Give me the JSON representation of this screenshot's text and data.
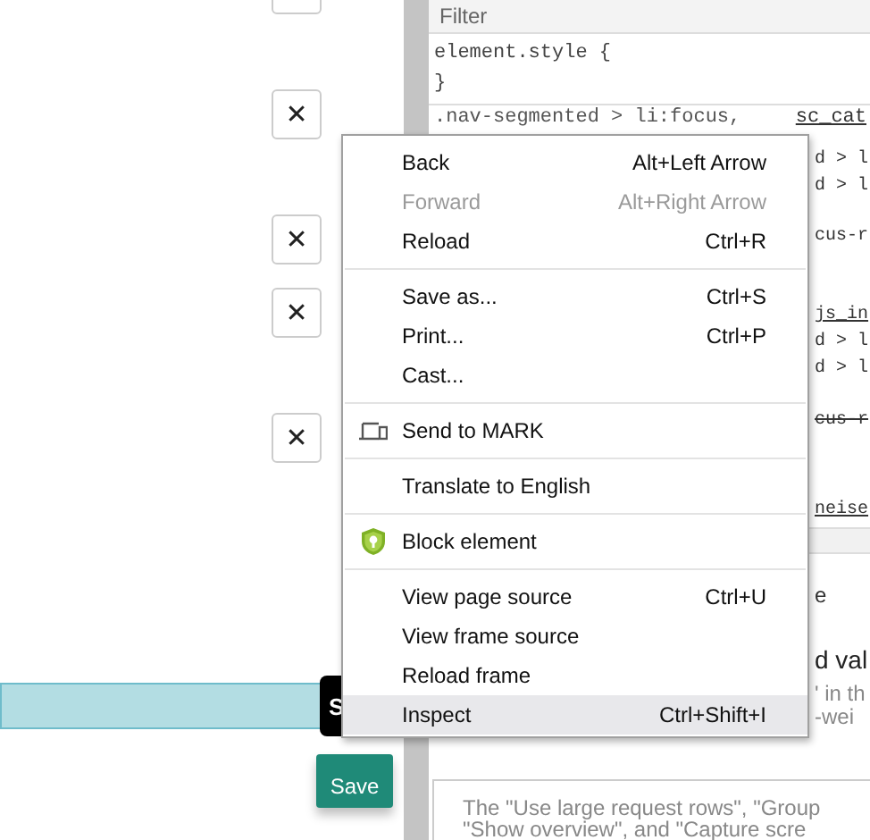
{
  "page": {
    "close_buttons": [
      {
        "kind": "cut"
      },
      {
        "kind": "x",
        "glyph": "✕"
      },
      {
        "kind": "x",
        "glyph": "✕"
      },
      {
        "kind": "x",
        "glyph": "✕"
      },
      {
        "kind": "x",
        "glyph": "✕"
      }
    ],
    "tooltip": "S",
    "save_button": "Save"
  },
  "devtools": {
    "filter": {
      "placeholder": "Filter"
    },
    "element_style": [
      "element.style {",
      "}"
    ],
    "rule": {
      "selector": ".nav-segmented > li:focus,",
      "source": "sc_cat"
    },
    "fragments": [
      {
        "kind": "code",
        "text": "d > l"
      },
      {
        "kind": "code",
        "text": "d > l"
      },
      {
        "kind": "code",
        "text": "cus-r"
      },
      {
        "kind": "link",
        "text": "js_in"
      },
      {
        "kind": "code",
        "text": "d > l"
      },
      {
        "kind": "code",
        "text": "d > l"
      },
      {
        "kind": "strike",
        "text": "cus-r"
      },
      {
        "kind": "link",
        "text": "neise"
      },
      {
        "kind": "band"
      },
      {
        "kind": "plain",
        "text": "e"
      },
      {
        "kind": "heading",
        "text": "d val"
      },
      {
        "kind": "muted",
        "text": "' in th"
      },
      {
        "kind": "muted",
        "text": "-wei"
      }
    ],
    "note_lines": [
      "The \"Use large request rows\", \"Group",
      "\"Show overview\", and \"Capture scre"
    ]
  },
  "context_menu": {
    "items": [
      {
        "kind": "item",
        "label": "Back",
        "shortcut": "Alt+Left Arrow",
        "disabled": false,
        "selected": false
      },
      {
        "kind": "item",
        "label": "Forward",
        "shortcut": "Alt+Right Arrow",
        "disabled": true,
        "selected": false
      },
      {
        "kind": "item",
        "label": "Reload",
        "shortcut": "Ctrl+R",
        "disabled": false,
        "selected": false
      },
      {
        "kind": "divider"
      },
      {
        "kind": "item",
        "label": "Save as...",
        "shortcut": "Ctrl+S",
        "disabled": false,
        "selected": false
      },
      {
        "kind": "item",
        "label": "Print...",
        "shortcut": "Ctrl+P",
        "disabled": false,
        "selected": false
      },
      {
        "kind": "item",
        "label": "Cast...",
        "disabled": false,
        "selected": false
      },
      {
        "kind": "divider"
      },
      {
        "kind": "device_item",
        "label": "Send to MARK",
        "disabled": false,
        "selected": false
      },
      {
        "kind": "divider"
      },
      {
        "kind": "item",
        "label": "Translate to English",
        "disabled": false,
        "selected": false
      },
      {
        "kind": "divider"
      },
      {
        "kind": "shield_item",
        "label": "Block element",
        "disabled": false,
        "selected": false
      },
      {
        "kind": "divider"
      },
      {
        "kind": "item",
        "label": "View page source",
        "shortcut": "Ctrl+U",
        "disabled": false,
        "selected": false
      },
      {
        "kind": "item",
        "label": "View frame source",
        "disabled": false,
        "selected": false
      },
      {
        "kind": "item",
        "label": "Reload frame",
        "disabled": false,
        "selected": false
      },
      {
        "kind": "item",
        "label": "Inspect",
        "shortcut": "Ctrl+Shift+I",
        "disabled": false,
        "selected": true
      }
    ]
  }
}
